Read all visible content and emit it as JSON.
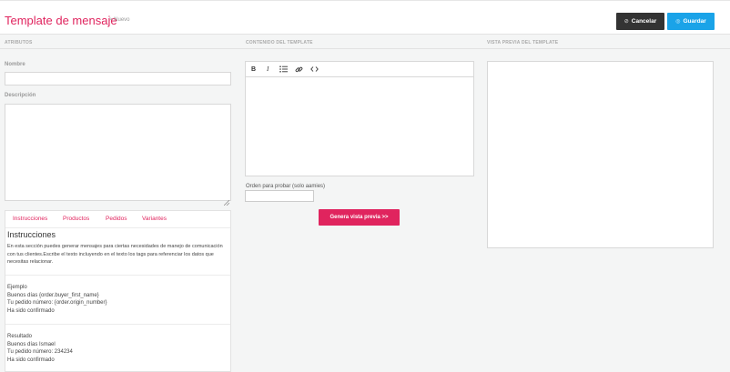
{
  "header": {
    "title": "Template de mensaje",
    "breadcrumb": "> Nuevo",
    "cancel_label": "Cancelar",
    "save_label": "Guardar",
    "cancel_icon": "circle-x-icon",
    "save_icon": "save-icon"
  },
  "columns": {
    "attributes": "ATRIBUTOS",
    "content": "CONTENIDO DEL TEMPLATE",
    "preview": "VISTA PREVIA DEL TEMPLATE"
  },
  "form": {
    "name_label": "Nombre",
    "name_value": "",
    "description_label": "Descripción",
    "description_value": ""
  },
  "help": {
    "tabs": [
      "Instrucciones",
      "Productos",
      "Pedidos",
      "Variantes"
    ],
    "title": "Instrucciones",
    "text": "En esta sección puedes generar mensajes para ciertas necesidades de manejo de comunicación con tus clientes.Escribe el texto incluyendo en el texto los tags para referenciar los datos que necesitas relacionar.",
    "example": {
      "heading": "Ejemplo",
      "lines": [
        "Buenos días {order.buyer_first_name}",
        "Tu pedido número: {order.origin_number}",
        "Ha sido confirmado"
      ]
    },
    "result": {
      "heading": "Resultado",
      "lines": [
        "Buenos días Ismael",
        "Tu pedido número: 234234",
        "Ha sido confirmado"
      ]
    }
  },
  "editor": {
    "toolbar": [
      "B",
      "I",
      "list",
      "link",
      "code"
    ],
    "content": ""
  },
  "order": {
    "label": "Orden para probar (solo aamies)",
    "value": ""
  },
  "preview_button": "Genera vista previa >>",
  "colors": {
    "accent": "#e0245e",
    "primary": "#1aa3e8",
    "dark": "#333333"
  }
}
